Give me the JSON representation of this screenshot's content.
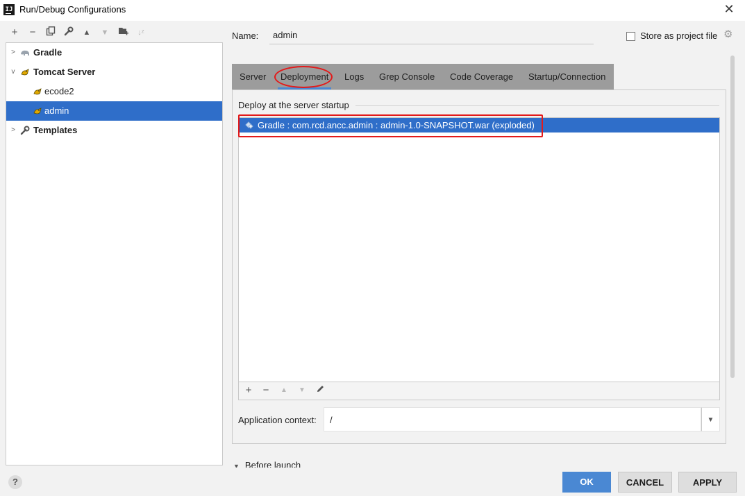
{
  "window": {
    "title": "Run/Debug Configurations",
    "app_icon_label": "IJ"
  },
  "tree": {
    "items": [
      {
        "label": "Gradle"
      },
      {
        "label": "Tomcat Server"
      },
      {
        "label": "ecode2"
      },
      {
        "label": "admin"
      },
      {
        "label": "Templates"
      }
    ]
  },
  "name_field": {
    "label": "Name:",
    "value": "admin"
  },
  "store_option": {
    "label": "Store as project file",
    "checked": false
  },
  "tabs": [
    {
      "label": "Server"
    },
    {
      "label": "Deployment",
      "active": true
    },
    {
      "label": "Logs"
    },
    {
      "label": "Grep Console"
    },
    {
      "label": "Code Coverage"
    },
    {
      "label": "Startup/Connection"
    }
  ],
  "deployment": {
    "group_title": "Deploy at the server startup",
    "items": [
      "Gradle : com.rcd.ancc.admin : admin-1.0-SNAPSHOT.war (exploded)"
    ]
  },
  "app_context": {
    "label": "Application context:",
    "value": "/"
  },
  "before_launch_label": "Before launch",
  "buttons": {
    "ok": "OK",
    "cancel": "CANCEL",
    "apply": "APPLY"
  },
  "colors": {
    "selection": "#2f6ec9",
    "accent": "#4a88d3",
    "annotation": "#e31a1a"
  }
}
